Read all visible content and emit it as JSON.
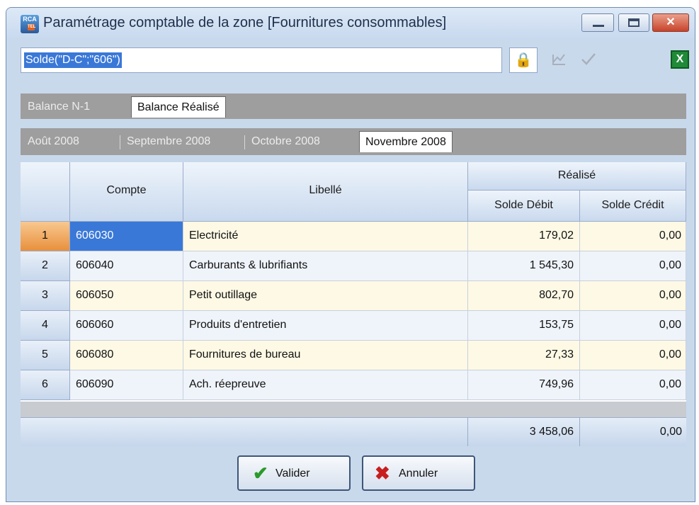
{
  "window": {
    "title": "Paramétrage comptable de la zone [Fournitures consommables]",
    "icon_text_top": "RCA",
    "icon_text_bottom": "TEL",
    "close_glyph": "✕",
    "controls": [
      "minimize-icon",
      "maximize-icon",
      "close-icon"
    ]
  },
  "formula": {
    "value": "Solde(\"D-C\";\"606\")"
  },
  "toolbar": {
    "icons": [
      "lock-icon",
      "chart-icon",
      "check-icon",
      "excel-icon"
    ],
    "excel_glyph": "X"
  },
  "tabs_level1": [
    {
      "label": "Balance N-1",
      "active": false
    },
    {
      "label": "Balance Réalisé",
      "active": true
    }
  ],
  "tabs_level2": [
    {
      "label": "Août 2008",
      "active": false
    },
    {
      "label": "Septembre 2008",
      "active": false
    },
    {
      "label": "Octobre 2008",
      "active": false
    },
    {
      "label": "Novembre 2008",
      "active": true
    }
  ],
  "table": {
    "headers": {
      "compte": "Compte",
      "libelle": "Libellé",
      "group": "Réalisé",
      "debit": "Solde Débit",
      "credit": "Solde Crédit"
    },
    "rows": [
      {
        "n": "1",
        "compte": "606030",
        "libelle": "Electricité",
        "debit": "179,02",
        "credit": "0,00"
      },
      {
        "n": "2",
        "compte": "606040",
        "libelle": "Carburants & lubrifiants",
        "debit": "1 545,30",
        "credit": "0,00"
      },
      {
        "n": "3",
        "compte": "606050",
        "libelle": "Petit outillage",
        "debit": "802,70",
        "credit": "0,00"
      },
      {
        "n": "4",
        "compte": "606060",
        "libelle": "Produits d'entretien",
        "debit": "153,75",
        "credit": "0,00"
      },
      {
        "n": "5",
        "compte": "606080",
        "libelle": "Fournitures de bureau",
        "debit": "27,33",
        "credit": "0,00"
      },
      {
        "n": "6",
        "compte": "606090",
        "libelle": "Ach. réepreuve",
        "debit": "749,96",
        "credit": "0,00"
      }
    ],
    "totals": {
      "debit": "3 458,06",
      "credit": "0,00"
    },
    "selected_row": 1
  },
  "buttons": {
    "valider": "Valider",
    "annuler": "Annuler"
  },
  "colors": {
    "selection": "#3a78d8",
    "row_odd": "#fdf9e5",
    "row_even": "#eff4fb",
    "tab_strip": "#9e9e9e",
    "valider_icon": "#2a9a2a",
    "annuler_icon": "#c81e1e"
  }
}
